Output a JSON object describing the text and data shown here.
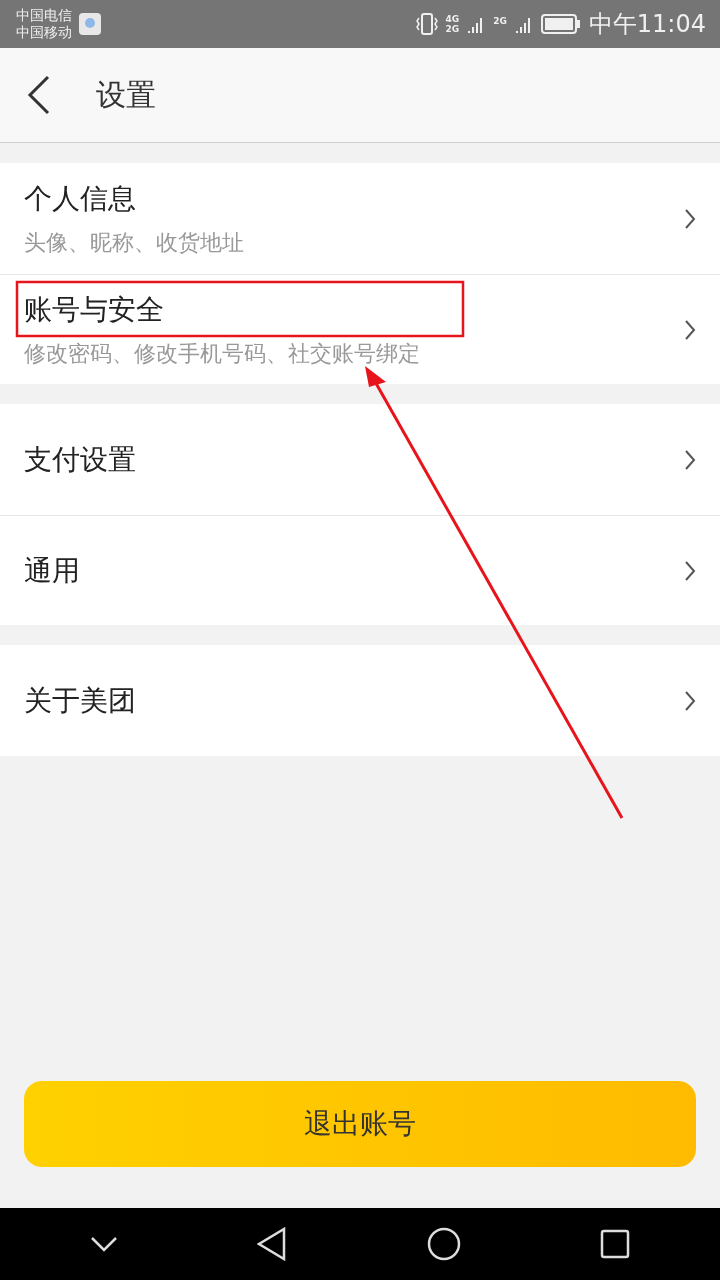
{
  "status_bar": {
    "carriers": [
      "中国电信",
      "中国移动"
    ],
    "network_labels": [
      "4G",
      "2G",
      "2G"
    ],
    "time": "中午11:04"
  },
  "header": {
    "title": "设置"
  },
  "groups": [
    {
      "items": [
        {
          "title": "个人信息",
          "subtitle": "头像、昵称、收货地址",
          "highlighted": false
        },
        {
          "title": "账号与安全",
          "subtitle": "修改密码、修改手机号码、社交账号绑定",
          "highlighted": true
        }
      ]
    },
    {
      "items": [
        {
          "title": "支付设置",
          "highlighted": false
        },
        {
          "title": "通用",
          "highlighted": false
        }
      ]
    },
    {
      "items": [
        {
          "title": "关于美团",
          "highlighted": false
        }
      ]
    }
  ],
  "logout_button": {
    "label": "退出账号"
  }
}
